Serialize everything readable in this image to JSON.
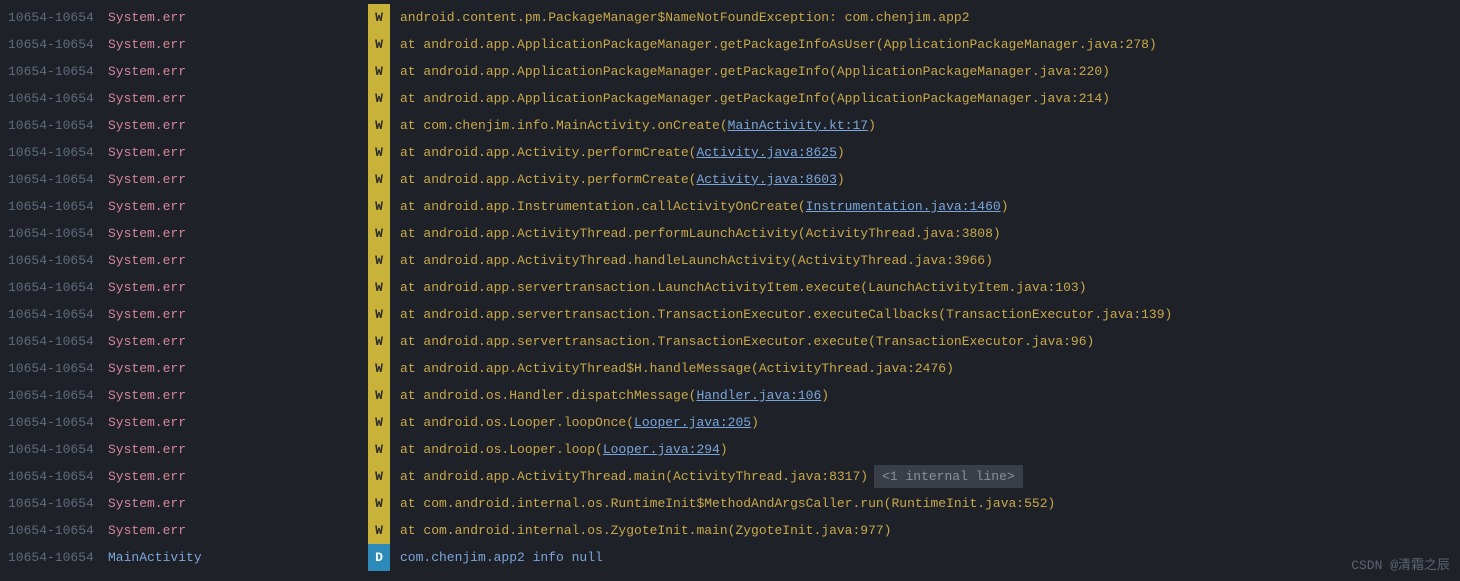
{
  "watermark": "CSDN @清霜之辰",
  "lines": [
    {
      "pid": "10654-10654",
      "tag": "System.err",
      "tagClass": "tag-err",
      "level": "W",
      "msgClass": "msg",
      "segments": [
        {
          "t": "android.content.pm.PackageManager$NameNotFoundException: com.chenjim.app2"
        }
      ]
    },
    {
      "pid": "10654-10654",
      "tag": "System.err",
      "tagClass": "tag-err",
      "level": "W",
      "msgClass": "msg",
      "segments": [
        {
          "t": "   at android.app.ApplicationPackageManager.getPackageInfoAsUser(ApplicationPackageManager.java:278)"
        }
      ]
    },
    {
      "pid": "10654-10654",
      "tag": "System.err",
      "tagClass": "tag-err",
      "level": "W",
      "msgClass": "msg",
      "segments": [
        {
          "t": "   at android.app.ApplicationPackageManager.getPackageInfo(ApplicationPackageManager.java:220)"
        }
      ]
    },
    {
      "pid": "10654-10654",
      "tag": "System.err",
      "tagClass": "tag-err",
      "level": "W",
      "msgClass": "msg",
      "segments": [
        {
          "t": "   at android.app.ApplicationPackageManager.getPackageInfo(ApplicationPackageManager.java:214)"
        }
      ]
    },
    {
      "pid": "10654-10654",
      "tag": "System.err",
      "tagClass": "tag-err",
      "level": "W",
      "msgClass": "msg",
      "segments": [
        {
          "t": "   at com.chenjim.info.MainActivity.onCreate("
        },
        {
          "t": "MainActivity.kt:17",
          "link": true
        },
        {
          "t": ")"
        }
      ]
    },
    {
      "pid": "10654-10654",
      "tag": "System.err",
      "tagClass": "tag-err",
      "level": "W",
      "msgClass": "msg",
      "segments": [
        {
          "t": "   at android.app.Activity.performCreate("
        },
        {
          "t": "Activity.java:8625",
          "link": true
        },
        {
          "t": ")"
        }
      ]
    },
    {
      "pid": "10654-10654",
      "tag": "System.err",
      "tagClass": "tag-err",
      "level": "W",
      "msgClass": "msg",
      "segments": [
        {
          "t": "   at android.app.Activity.performCreate("
        },
        {
          "t": "Activity.java:8603",
          "link": true
        },
        {
          "t": ")"
        }
      ]
    },
    {
      "pid": "10654-10654",
      "tag": "System.err",
      "tagClass": "tag-err",
      "level": "W",
      "msgClass": "msg",
      "segments": [
        {
          "t": "   at android.app.Instrumentation.callActivityOnCreate("
        },
        {
          "t": "Instrumentation.java:1460",
          "link": true
        },
        {
          "t": ")"
        }
      ]
    },
    {
      "pid": "10654-10654",
      "tag": "System.err",
      "tagClass": "tag-err",
      "level": "W",
      "msgClass": "msg",
      "segments": [
        {
          "t": "   at android.app.ActivityThread.performLaunchActivity(ActivityThread.java:3808)"
        }
      ]
    },
    {
      "pid": "10654-10654",
      "tag": "System.err",
      "tagClass": "tag-err",
      "level": "W",
      "msgClass": "msg",
      "segments": [
        {
          "t": "   at android.app.ActivityThread.handleLaunchActivity(ActivityThread.java:3966)"
        }
      ]
    },
    {
      "pid": "10654-10654",
      "tag": "System.err",
      "tagClass": "tag-err",
      "level": "W",
      "msgClass": "msg",
      "segments": [
        {
          "t": "   at android.app.servertransaction.LaunchActivityItem.execute(LaunchActivityItem.java:103)"
        }
      ]
    },
    {
      "pid": "10654-10654",
      "tag": "System.err",
      "tagClass": "tag-err",
      "level": "W",
      "msgClass": "msg",
      "segments": [
        {
          "t": "   at android.app.servertransaction.TransactionExecutor.executeCallbacks(TransactionExecutor.java:139)"
        }
      ]
    },
    {
      "pid": "10654-10654",
      "tag": "System.err",
      "tagClass": "tag-err",
      "level": "W",
      "msgClass": "msg",
      "segments": [
        {
          "t": "   at android.app.servertransaction.TransactionExecutor.execute(TransactionExecutor.java:96)"
        }
      ]
    },
    {
      "pid": "10654-10654",
      "tag": "System.err",
      "tagClass": "tag-err",
      "level": "W",
      "msgClass": "msg",
      "segments": [
        {
          "t": "   at android.app.ActivityThread$H.handleMessage(ActivityThread.java:2476)"
        }
      ]
    },
    {
      "pid": "10654-10654",
      "tag": "System.err",
      "tagClass": "tag-err",
      "level": "W",
      "msgClass": "msg",
      "segments": [
        {
          "t": "   at android.os.Handler.dispatchMessage("
        },
        {
          "t": "Handler.java:106",
          "link": true
        },
        {
          "t": ")"
        }
      ]
    },
    {
      "pid": "10654-10654",
      "tag": "System.err",
      "tagClass": "tag-err",
      "level": "W",
      "msgClass": "msg",
      "segments": [
        {
          "t": "   at android.os.Looper.loopOnce("
        },
        {
          "t": "Looper.java:205",
          "link": true
        },
        {
          "t": ")"
        }
      ]
    },
    {
      "pid": "10654-10654",
      "tag": "System.err",
      "tagClass": "tag-err",
      "level": "W",
      "msgClass": "msg",
      "segments": [
        {
          "t": "   at android.os.Looper.loop("
        },
        {
          "t": "Looper.java:294",
          "link": true
        },
        {
          "t": ")"
        }
      ]
    },
    {
      "pid": "10654-10654",
      "tag": "System.err",
      "tagClass": "tag-err",
      "level": "W",
      "msgClass": "msg",
      "segments": [
        {
          "t": "   at android.app.ActivityThread.main(ActivityThread.java:8317)"
        }
      ],
      "badge": "<1 internal line>"
    },
    {
      "pid": "10654-10654",
      "tag": "System.err",
      "tagClass": "tag-err",
      "level": "W",
      "msgClass": "msg",
      "segments": [
        {
          "t": "   at com.android.internal.os.RuntimeInit$MethodAndArgsCaller.run(RuntimeInit.java:552)"
        }
      ]
    },
    {
      "pid": "10654-10654",
      "tag": "System.err",
      "tagClass": "tag-err",
      "level": "W",
      "msgClass": "msg",
      "segments": [
        {
          "t": "   at com.android.internal.os.ZygoteInit.main(ZygoteInit.java:977)"
        }
      ]
    },
    {
      "pid": "10654-10654",
      "tag": "MainActivity",
      "tagClass": "tag-main",
      "level": "D",
      "msgClass": "msg-d",
      "segments": [
        {
          "t": "com.chenjim.app2 info null"
        }
      ]
    }
  ]
}
